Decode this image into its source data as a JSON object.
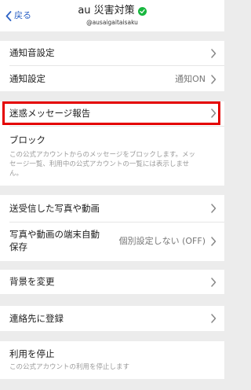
{
  "header": {
    "back_label": "戻る",
    "title": "au 災害対策",
    "subtitle": "@ausaigaitaisaku"
  },
  "section1": {
    "notification_sound": "通知音設定",
    "notification_settings": "通知設定",
    "notification_value": "通知ON"
  },
  "section2": {
    "report_spam": "迷惑メッセージ報告",
    "block": "ブロック",
    "block_desc_line1": "この公式アカウントからのメッセージをブロックします。メッ",
    "block_desc_line2": "セージ一覧、利用中の公式アカウントの一覧には表示しませ",
    "block_desc_line3": "ん。"
  },
  "section3": {
    "sent_media": "送受信した写真や動画",
    "auto_save_line1": "写真や動画の端末自動",
    "auto_save_line2": "保存",
    "auto_save_value": "個別設定しない (OFF)"
  },
  "section4": {
    "change_background": "背景を変更"
  },
  "section5": {
    "add_contact": "連絡先に登録"
  },
  "section6": {
    "stop_using": "利用を停止",
    "stop_desc": "この公式アカウントの利用を停止します"
  },
  "colors": {
    "accent": "#2c62c6",
    "verified": "#17b73e",
    "highlight": "#e40000",
    "background": "#ececec"
  },
  "icons": [
    "chevron-left-icon",
    "verified-check-icon",
    "chevron-right-icon"
  ]
}
